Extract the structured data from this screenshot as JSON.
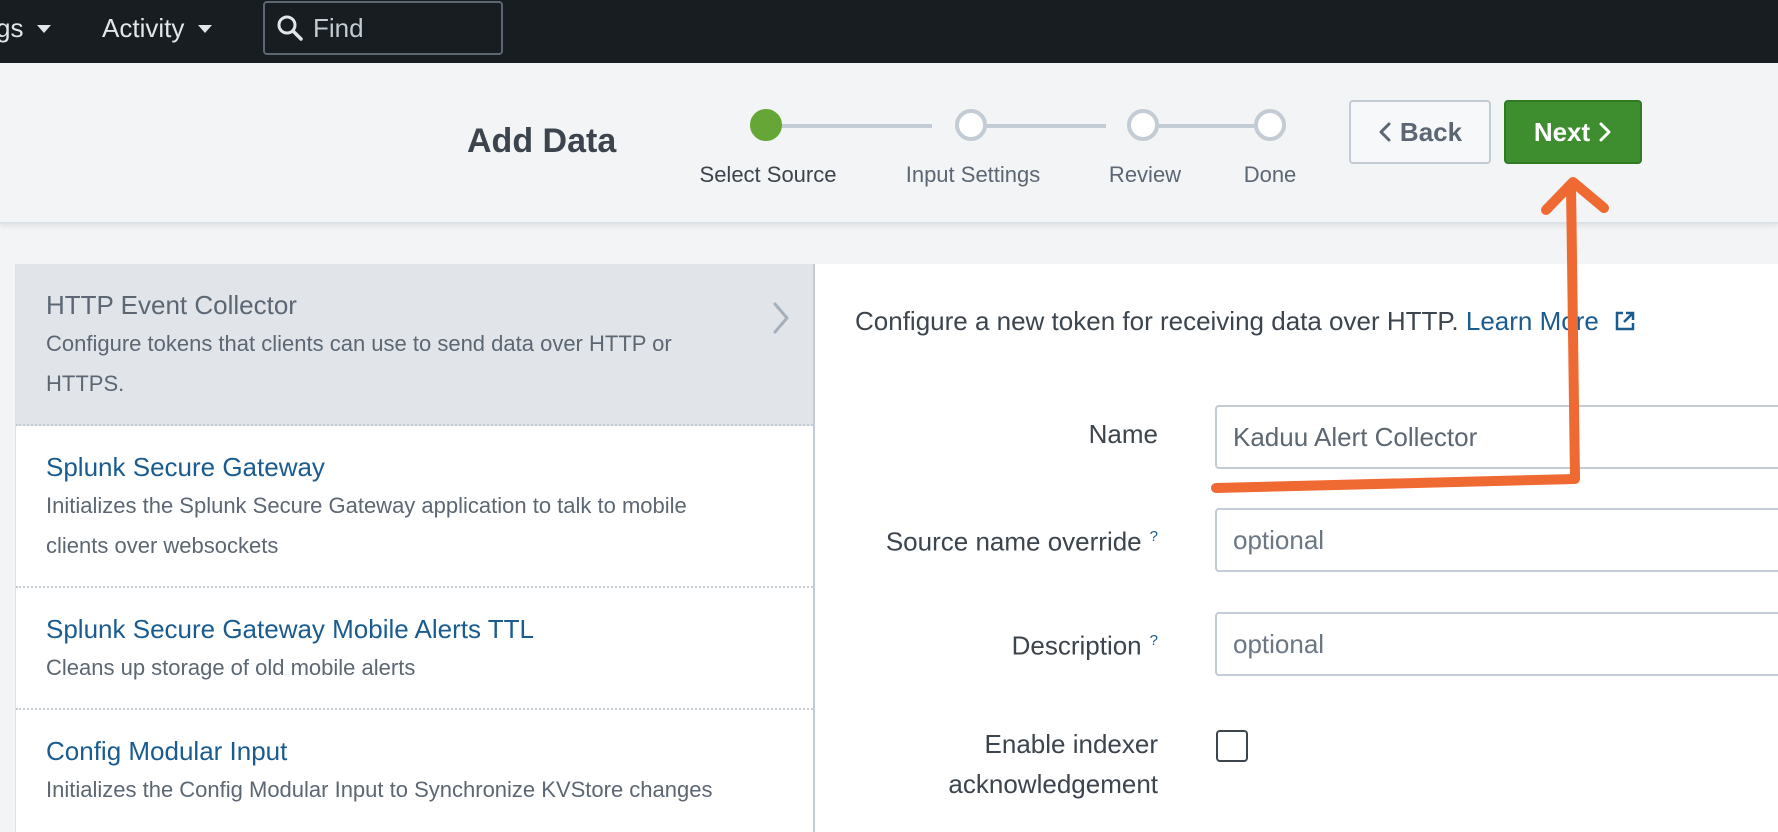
{
  "topbar": {
    "settings_label": "gs",
    "activity_label": "Activity",
    "find_placeholder": "Find"
  },
  "header": {
    "title": "Add Data",
    "steps": [
      {
        "label": "Select Source",
        "state": "active"
      },
      {
        "label": "Input Settings",
        "state": "pending"
      },
      {
        "label": "Review",
        "state": "pending"
      },
      {
        "label": "Done",
        "state": "pending"
      }
    ],
    "back_label": "Back",
    "next_label": "Next"
  },
  "sources": [
    {
      "title": "HTTP Event Collector",
      "desc": "Configure tokens that clients can use to send data over HTTP or HTTPS.",
      "selected": true
    },
    {
      "title": "Splunk Secure Gateway",
      "desc": "Initializes the Splunk Secure Gateway application to talk to mobile clients over websockets",
      "selected": false
    },
    {
      "title": "Splunk Secure Gateway Mobile Alerts TTL",
      "desc": "Cleans up storage of old mobile alerts",
      "selected": false
    },
    {
      "title": "Config Modular Input",
      "desc": "Initializes the Config Modular Input to Synchronize KVStore changes",
      "selected": false
    }
  ],
  "panel": {
    "intro_text": "Configure a new token for receiving data over HTTP.",
    "learn_more_label": "Learn More",
    "name_label": "Name",
    "name_value": "Kaduu Alert Collector",
    "source_override_label": "Source name override",
    "source_override_placeholder": "optional",
    "description_label": "Description",
    "description_placeholder": "optional",
    "help_mark": "?",
    "ack_label_line1": "Enable indexer",
    "ack_label_line2": "acknowledgement"
  },
  "colors": {
    "topbar_bg": "#171d21",
    "accent_green": "#3e8d2f",
    "link_blue": "#1a5c8f",
    "annotation_orange": "#ee6a32"
  }
}
